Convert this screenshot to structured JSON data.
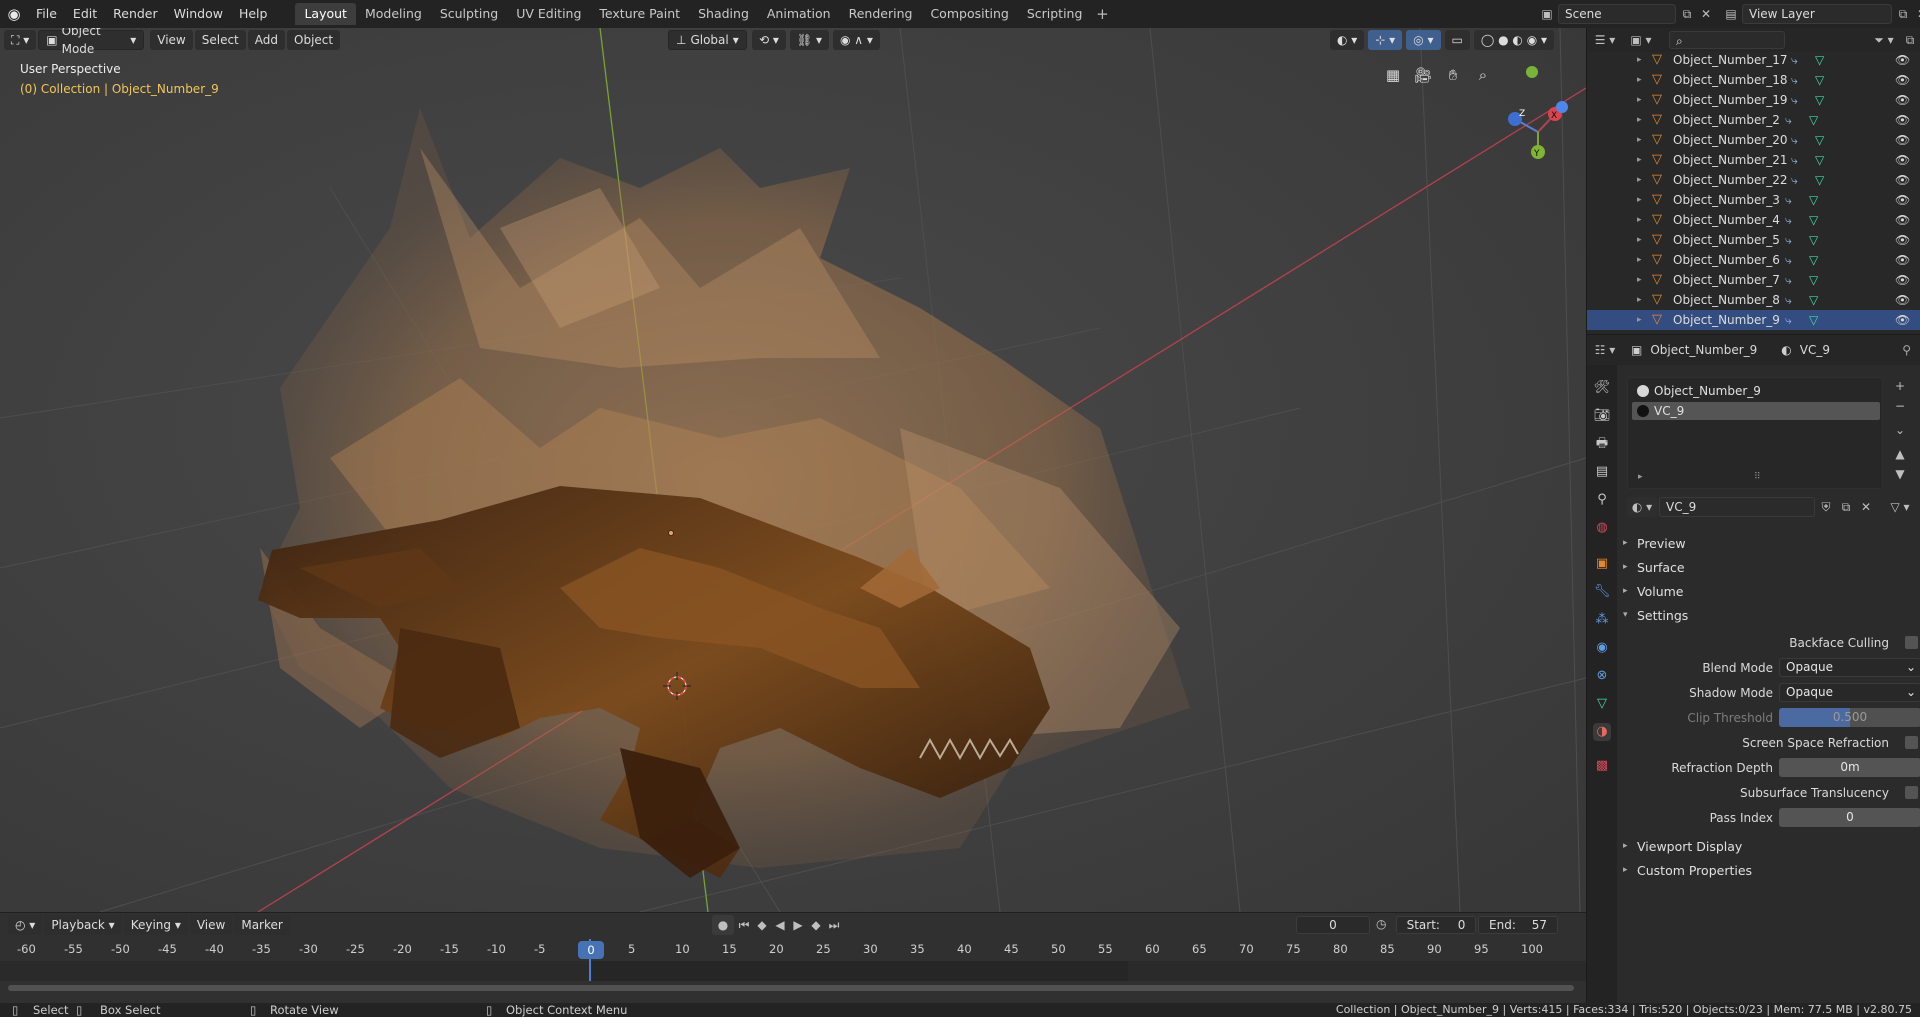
{
  "topbar": {
    "menus": [
      "File",
      "Edit",
      "Render",
      "Window",
      "Help"
    ],
    "workspaces": [
      "Layout",
      "Modeling",
      "Sculpting",
      "UV Editing",
      "Texture Paint",
      "Shading",
      "Animation",
      "Rendering",
      "Compositing",
      "Scripting"
    ],
    "active_workspace": "Layout",
    "add_tab": "+",
    "scene": "Scene",
    "view_layer": "View Layer"
  },
  "viewport": {
    "mode": "Object Mode",
    "menus": [
      "View",
      "Select",
      "Add",
      "Object"
    ],
    "orientation": "Global",
    "perspective_label": "User Perspective",
    "collection_label": "(0) Collection | Object_Number_9",
    "gizmo": {
      "x": "X",
      "y": "Y",
      "z": "Z"
    }
  },
  "timeline": {
    "playback": "Playback",
    "keying": "Keying",
    "view": "View",
    "marker": "Marker",
    "current_frame": "0",
    "start_label": "Start:",
    "start_value": "0",
    "end_label": "End:",
    "end_value": "57",
    "ruler": [
      "-60",
      "-55",
      "-50",
      "-45",
      "-40",
      "-35",
      "-30",
      "-25",
      "-20",
      "-15",
      "-10",
      "-5",
      "0",
      "5",
      "10",
      "15",
      "20",
      "25",
      "30",
      "35",
      "40",
      "45",
      "50",
      "55",
      "60",
      "65",
      "70",
      "75",
      "80",
      "85",
      "90",
      "95",
      "100"
    ],
    "playhead": "0"
  },
  "outliner": {
    "search_placeholder": "",
    "items": [
      {
        "name": "Object_Number_17",
        "selected": false
      },
      {
        "name": "Object_Number_18",
        "selected": false
      },
      {
        "name": "Object_Number_19",
        "selected": false
      },
      {
        "name": "Object_Number_2",
        "selected": false
      },
      {
        "name": "Object_Number_20",
        "selected": false
      },
      {
        "name": "Object_Number_21",
        "selected": false
      },
      {
        "name": "Object_Number_22",
        "selected": false
      },
      {
        "name": "Object_Number_3",
        "selected": false
      },
      {
        "name": "Object_Number_4",
        "selected": false
      },
      {
        "name": "Object_Number_5",
        "selected": false
      },
      {
        "name": "Object_Number_6",
        "selected": false
      },
      {
        "name": "Object_Number_7",
        "selected": false
      },
      {
        "name": "Object_Number_8",
        "selected": false
      },
      {
        "name": "Object_Number_9",
        "selected": true
      }
    ]
  },
  "properties": {
    "object_name": "Object_Number_9",
    "material_name": "VC_9",
    "slots": [
      "Object_Number_9",
      "VC_9"
    ],
    "material_field": "VC_9",
    "panels": {
      "preview": "Preview",
      "surface": "Surface",
      "volume": "Volume",
      "settings": "Settings",
      "viewport_display": "Viewport Display",
      "custom_properties": "Custom Properties"
    },
    "settings": {
      "backface_culling": "Backface Culling",
      "blend_mode_label": "Blend Mode",
      "blend_mode": "Opaque",
      "shadow_mode_label": "Shadow Mode",
      "shadow_mode": "Opaque",
      "clip_threshold_label": "Clip Threshold",
      "clip_threshold": "0.500",
      "screen_space_refraction": "Screen Space Refraction",
      "refraction_depth_label": "Refraction Depth",
      "refraction_depth": "0m",
      "subsurface_translucency": "Subsurface Translucency",
      "pass_index_label": "Pass Index",
      "pass_index": "0"
    }
  },
  "statusbar": {
    "select": "Select",
    "box_select": "Box Select",
    "rotate_view": "Rotate View",
    "context_menu": "Object Context Menu",
    "stats": "Collection | Object_Number_9 | Verts:415 | Faces:334 | Tris:520 | Objects:0/23 | Mem: 77.5 MB | v2.80.75"
  }
}
